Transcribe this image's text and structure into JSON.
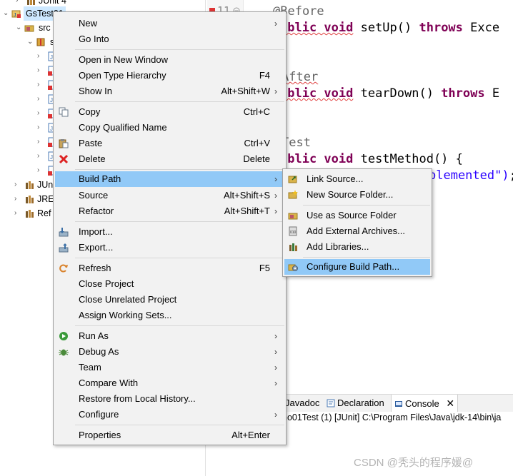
{
  "explorer": {
    "items": [
      {
        "label": "JUnit 4"
      },
      {
        "label": "GsTest01"
      },
      {
        "label": "src"
      },
      {
        "label": "s"
      },
      {
        "label": "JUn"
      },
      {
        "label": "JRE"
      },
      {
        "label": "Ref"
      }
    ]
  },
  "editor": {
    "line_number": "11",
    "lines": {
      "l1_ann": "@Before",
      "l2_kw": "ublic void",
      "l2_rest": " setUp() ",
      "l2_kw2": "throws",
      "l2_tail": " Exce",
      "l3_ann": "After",
      "l4_kw": "ublic void",
      "l4_rest": " tearDown() ",
      "l4_kw2": "throws",
      "l4_tail": " E",
      "l5_ann": "Test",
      "l6_kw": "ublic void",
      "l6_rest": " testMethod() {",
      "l7_str": "plemented\")",
      "l7_tail": ";"
    }
  },
  "bottom_panel": {
    "tabs": [
      {
        "label": "Javadoc"
      },
      {
        "label": "Declaration"
      },
      {
        "label": "Console"
      }
    ],
    "console_status": "no01Test (1) [JUnit] C:\\Program Files\\Java\\jdk-14\\bin\\ja"
  },
  "context_menu": {
    "items": [
      {
        "label": "New",
        "shortcut": ""
      },
      {
        "label": "Go Into",
        "shortcut": ""
      },
      {
        "label": "Open in New Window",
        "shortcut": ""
      },
      {
        "label": "Open Type Hierarchy",
        "shortcut": "F4"
      },
      {
        "label": "Show In",
        "shortcut": "Alt+Shift+W"
      },
      {
        "label": "Copy",
        "shortcut": "Ctrl+C"
      },
      {
        "label": "Copy Qualified Name",
        "shortcut": ""
      },
      {
        "label": "Paste",
        "shortcut": "Ctrl+V"
      },
      {
        "label": "Delete",
        "shortcut": "Delete"
      },
      {
        "label": "Build Path",
        "shortcut": ""
      },
      {
        "label": "Source",
        "shortcut": "Alt+Shift+S"
      },
      {
        "label": "Refactor",
        "shortcut": "Alt+Shift+T"
      },
      {
        "label": "Import...",
        "shortcut": ""
      },
      {
        "label": "Export...",
        "shortcut": ""
      },
      {
        "label": "Refresh",
        "shortcut": "F5"
      },
      {
        "label": "Close Project",
        "shortcut": ""
      },
      {
        "label": "Close Unrelated Project",
        "shortcut": ""
      },
      {
        "label": "Assign Working Sets...",
        "shortcut": ""
      },
      {
        "label": "Run As",
        "shortcut": ""
      },
      {
        "label": "Debug As",
        "shortcut": ""
      },
      {
        "label": "Team",
        "shortcut": ""
      },
      {
        "label": "Compare With",
        "shortcut": ""
      },
      {
        "label": "Restore from Local History...",
        "shortcut": ""
      },
      {
        "label": "Configure",
        "shortcut": ""
      },
      {
        "label": "Properties",
        "shortcut": "Alt+Enter"
      }
    ],
    "highlighted": "Build Path"
  },
  "build_path_submenu": {
    "items": [
      {
        "label": "Link Source..."
      },
      {
        "label": "New Source Folder..."
      },
      {
        "label": "Use as Source Folder"
      },
      {
        "label": "Add External Archives..."
      },
      {
        "label": "Add Libraries..."
      },
      {
        "label": "Configure Build Path..."
      }
    ],
    "highlighted": "Configure Build Path..."
  },
  "watermark": "CSDN @秃头的程序媛@",
  "colors": {
    "menu_bg": "#f2f2f2",
    "menu_highlight": "#91c9f7",
    "keyword": "#7f0055",
    "string": "#2a00ff",
    "annotation": "#646464"
  }
}
